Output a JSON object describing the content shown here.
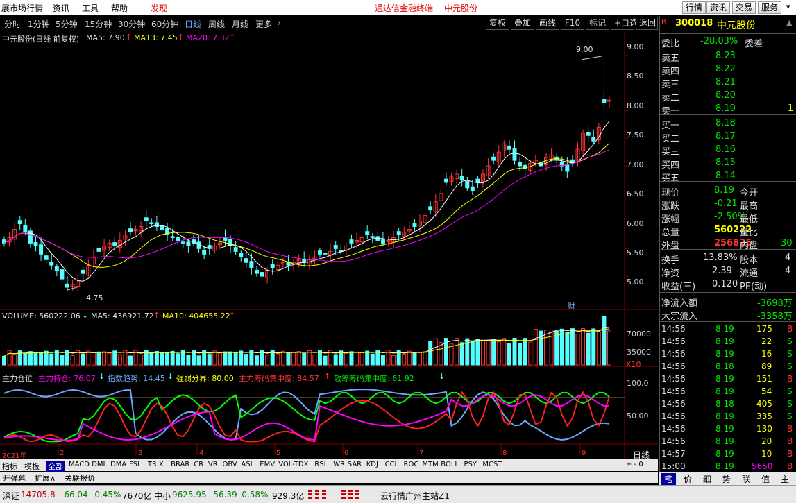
{
  "menubar": {
    "app_title": "展市场行情",
    "items": [
      "资讯",
      "工具",
      "帮助"
    ],
    "discover": "发现",
    "headline": "通达信金融终端",
    "stock": "中元股份",
    "right_buttons": [
      "行情",
      "资讯",
      "交易",
      "服务"
    ]
  },
  "periodbar": {
    "periods": [
      "分时",
      "1分钟",
      "5分钟",
      "15分钟",
      "30分钟",
      "60分钟",
      "日线",
      "周线",
      "月线",
      "更多"
    ],
    "more_arrow": "›",
    "right_buttons": [
      "复权",
      "叠加",
      "画线",
      "F10",
      "标记",
      "+自选",
      "返回"
    ]
  },
  "chart": {
    "main_title": "中元股份(日线 前复权)",
    "ma5": "MA5: 7.90",
    "ma13": "MA13: 7.45",
    "ma20": "MA20: 7.32",
    "price_ticks": [
      "9.00",
      "8.50",
      "8.00",
      "7.50",
      "7.00",
      "6.50",
      "6.00",
      "5.50",
      "5.00"
    ],
    "high_label": "9.00",
    "low_label": "4.75",
    "fin_label": "财",
    "vol_title": "VOLUME: 560222.06",
    "vol_ma5": "MA5: 436921.72",
    "vol_ma10": "MA10: 404655.22",
    "vol_ticks": [
      "70000",
      "35000"
    ],
    "vol_unit": "X10",
    "ind_labels": [
      "主力仓位",
      "主力持仓: 76.07",
      "指数趋势: 14.45",
      "强弱分界: 80.00",
      "主力筹码集中度: 84.57",
      "散筹筹码集中度: 61.92"
    ],
    "ind_ticks": [
      "100.0",
      "50.00"
    ],
    "x_labels": [
      "2021年",
      "2",
      "3",
      "4",
      "5",
      "6",
      "7",
      "8",
      "9"
    ],
    "period_label": "日线"
  },
  "chart_data": {
    "type": "candlestick",
    "x_months": [
      "2021年",
      "2",
      "3",
      "4",
      "5",
      "6",
      "7",
      "8",
      "9"
    ],
    "close": [
      5.6,
      5.7,
      5.85,
      5.95,
      5.8,
      5.6,
      5.55,
      5.4,
      5.3,
      5.2,
      5.1,
      4.95,
      4.8,
      4.85,
      4.9,
      5.05,
      5.2,
      5.35,
      5.45,
      5.55,
      5.6,
      5.55,
      5.65,
      5.75,
      5.8,
      5.85,
      5.9,
      6.0,
      5.95,
      5.9,
      5.85,
      5.75,
      5.7,
      5.65,
      5.6,
      5.55,
      5.6,
      5.5,
      5.4,
      5.5,
      5.55,
      5.6,
      5.65,
      5.55,
      5.45,
      5.35,
      5.25,
      5.15,
      5.05,
      5.0,
      5.1,
      5.15,
      5.2,
      5.25,
      5.2,
      5.25,
      5.3,
      5.25,
      5.3,
      5.35,
      5.4,
      5.4,
      5.45,
      5.5,
      5.45,
      5.55,
      5.6,
      5.65,
      5.7,
      5.75,
      5.7,
      5.65,
      5.6,
      5.65,
      5.7,
      5.75,
      5.8,
      5.85,
      5.9,
      6.0,
      6.1,
      6.2,
      6.35,
      6.5,
      6.7,
      6.8,
      6.85,
      6.75,
      6.6,
      6.55,
      6.7,
      6.85,
      7.0,
      7.1,
      7.25,
      7.4,
      7.3,
      7.1,
      7.0,
      6.95,
      7.05,
      7.1,
      7.0,
      7.15,
      7.2,
      7.1,
      7.0,
      6.9,
      7.05,
      7.3,
      7.6,
      7.55,
      7.45,
      7.7,
      8.15,
      8.19
    ],
    "last_price": 8.19,
    "high": 9.0,
    "low": 4.75,
    "price_ylim": [
      4.7,
      9.2
    ],
    "volume": {
      "last": 560222.06,
      "ma5": 436921.72,
      "ma10": 404655.22,
      "unit": "X10"
    },
    "indicators": {
      "主力持仓": 76.07,
      "指数趋势": 14.45,
      "强弱分界": 80.0,
      "主力筹码集中度": 84.57,
      "散筹筹码集中度": 61.92
    }
  },
  "quote": {
    "code": "300018",
    "name": "中元股份",
    "badge": "R",
    "webi": {
      "label": "委比",
      "value": "-28.03%",
      "label2": "委差"
    },
    "asks": [
      {
        "label": "卖五",
        "price": "8.23",
        "vol": ""
      },
      {
        "label": "卖四",
        "price": "8.22",
        "vol": ""
      },
      {
        "label": "卖三",
        "price": "8.21",
        "vol": ""
      },
      {
        "label": "卖二",
        "price": "8.20",
        "vol": ""
      },
      {
        "label": "卖一",
        "price": "8.19",
        "vol": "1"
      }
    ],
    "bids": [
      {
        "label": "买一",
        "price": "8.18",
        "vol": ""
      },
      {
        "label": "买二",
        "price": "8.17",
        "vol": ""
      },
      {
        "label": "买三",
        "price": "8.16",
        "vol": ""
      },
      {
        "label": "买四",
        "price": "8.15",
        "vol": ""
      },
      {
        "label": "买五",
        "price": "8.14",
        "vol": ""
      }
    ],
    "stats": [
      {
        "l": "现价",
        "v": "8.19",
        "l2": "今开",
        "v2": ""
      },
      {
        "l": "涨跌",
        "v": "-0.21",
        "l2": "最高",
        "v2": ""
      },
      {
        "l": "涨幅",
        "v": "-2.50%",
        "l2": "最低",
        "v2": ""
      },
      {
        "l": "总量",
        "v": "560222",
        "l2": "量比",
        "v2": ""
      },
      {
        "l": "外盘",
        "v": "256825",
        "l2": "内盘",
        "v2": "30"
      }
    ],
    "stats2": [
      {
        "l": "换手",
        "v": "13.83%",
        "l2": "股本",
        "v2": "4"
      },
      {
        "l": "净资",
        "v": "2.39",
        "l2": "流通",
        "v2": "4"
      },
      {
        "l": "收益(三)",
        "v": "0.120",
        "l2": "PE(动)",
        "v2": ""
      }
    ],
    "flow": [
      {
        "l": "净流入额",
        "v": "-3698万"
      },
      {
        "l": "大宗流入",
        "v": "-3358万"
      }
    ],
    "ticks": [
      {
        "t": "14:56",
        "p": "8.19",
        "v": "175",
        "s": "B"
      },
      {
        "t": "14:56",
        "p": "8.19",
        "v": "22",
        "s": "S"
      },
      {
        "t": "14:56",
        "p": "8.19",
        "v": "16",
        "s": "S"
      },
      {
        "t": "14:56",
        "p": "8.18",
        "v": "89",
        "s": "S"
      },
      {
        "t": "14:56",
        "p": "8.19",
        "v": "151",
        "s": "B"
      },
      {
        "t": "14:56",
        "p": "8.19",
        "v": "54",
        "s": "S"
      },
      {
        "t": "14:56",
        "p": "8.18",
        "v": "405",
        "s": "S"
      },
      {
        "t": "14:56",
        "p": "8.19",
        "v": "335",
        "s": "S"
      },
      {
        "t": "14:56",
        "p": "8.19",
        "v": "130",
        "s": "B"
      },
      {
        "t": "14:56",
        "p": "8.19",
        "v": "20",
        "s": "B"
      },
      {
        "t": "14:57",
        "p": "8.19",
        "v": "10",
        "s": "B"
      },
      {
        "t": "15:00",
        "p": "8.19",
        "v": "5650",
        "s": "B"
      }
    ],
    "bottom_tabs": [
      "笔",
      "价",
      "细",
      "势",
      "联",
      "值",
      "主"
    ]
  },
  "indicator_tabs": [
    "指标",
    "模板",
    "全部",
    "MACD",
    "DMI",
    "DMA",
    "FSL",
    "TRIX",
    "BRAR",
    "CR",
    "VR",
    "OBV",
    "ASI",
    "EMV",
    "VOL-TDX",
    "RSI",
    "WR",
    "SAR",
    "KDJ",
    "CCI",
    "ROC",
    "MTM",
    "BOLL",
    "PSY",
    "MCST"
  ],
  "bottom_bar": {
    "items": [
      "开弹幕",
      "扩展∧",
      "关联报价"
    ]
  },
  "status": {
    "sz_label": "深证",
    "sz_val": "14705.8",
    "sz_chg": "-66.04",
    "sz_pct": "-0.45%",
    "sz_amt": "7670亿",
    "zx_label": "中小",
    "zx_val": "9625.95",
    "zx_chg": "-56.39",
    "zx_pct": "-0.58%",
    "zx_amt": "929.3亿",
    "server": "云行情广州主站Z1"
  },
  "colors": {
    "up": "#ff3333",
    "down": "#54ffff",
    "ma5": "#ffffff",
    "ma13": "#ffff00",
    "ma20": "#ff00ff",
    "ind_blue": "#6ea7ff",
    "ind_green": "#00ff00",
    "ind_red": "#ff2020",
    "ind_magenta": "#ff00ff"
  }
}
